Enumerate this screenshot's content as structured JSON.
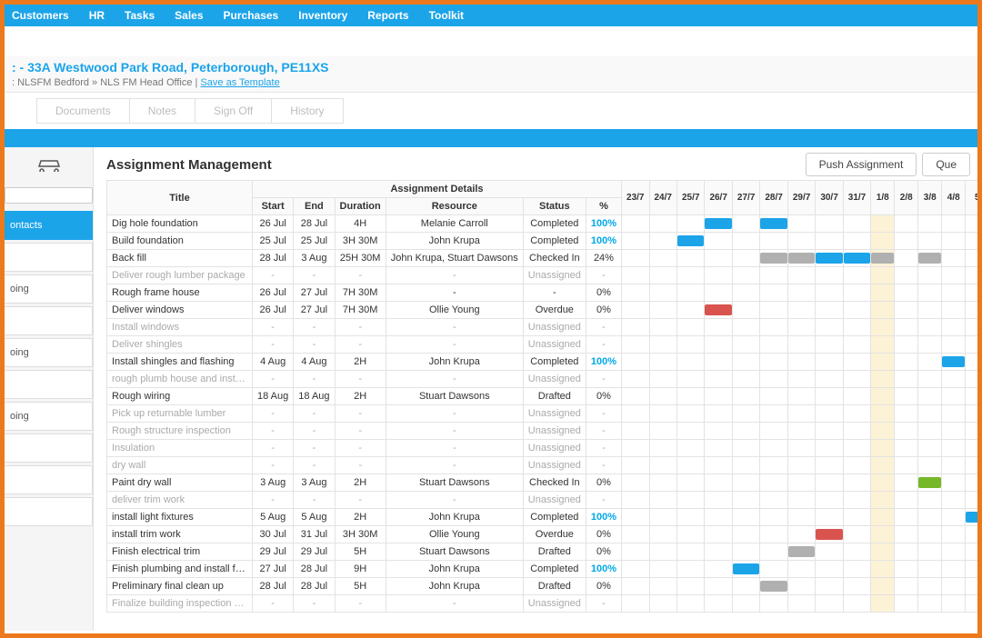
{
  "topnav": [
    "Customers",
    "HR",
    "Tasks",
    "Sales",
    "Purchases",
    "Inventory",
    "Reports",
    "Toolkit"
  ],
  "breadc": {
    "title": ": - 33A Westwood Park Road, Peterborough, PE11XS",
    "sub_prefix": ": NLSFM Bedford » NLS FM Head Office | ",
    "save_template": "Save as Template"
  },
  "tabs": [
    "Documents",
    "Notes",
    "Sign Off",
    "History"
  ],
  "sidebar": {
    "items": [
      {
        "label": "ontacts",
        "active": true
      },
      {
        "label": ""
      },
      {
        "label": "oing"
      },
      {
        "label": ""
      },
      {
        "label": "oing"
      },
      {
        "label": ""
      },
      {
        "label": "oing"
      },
      {
        "label": ""
      },
      {
        "label": ""
      },
      {
        "label": ""
      }
    ]
  },
  "content": {
    "heading": "Assignment Management",
    "push_btn": "Push Assignment",
    "queue_btn": "Que",
    "group_header": "Assignment Details",
    "columns": [
      "Title",
      "Start",
      "End",
      "Duration",
      "Resource",
      "Status",
      "%"
    ],
    "dates": [
      "23/7",
      "24/7",
      "25/7",
      "26/7",
      "27/7",
      "28/7",
      "29/7",
      "30/7",
      "31/7",
      "1/8",
      "2/8",
      "3/8",
      "4/8",
      "5"
    ],
    "highlight_index": 9,
    "rows": [
      {
        "title": "Dig hole foundation",
        "start": "26 Jul",
        "end": "28 Jul",
        "duration": "4H",
        "resource": "Melanie Carroll",
        "status": "Completed",
        "pct": "100%",
        "bars": [
          {
            "i": 3,
            "c": "blue"
          },
          {
            "i": 5,
            "c": "blue"
          }
        ]
      },
      {
        "title": "Build foundation",
        "start": "25 Jul",
        "end": "25 Jul",
        "duration": "3H 30M",
        "resource": "John Krupa",
        "status": "Completed",
        "pct": "100%",
        "bars": [
          {
            "i": 2,
            "c": "blue"
          }
        ]
      },
      {
        "title": "Back fill",
        "start": "28 Jul",
        "end": "3 Aug",
        "duration": "25H 30M",
        "resource": "John Krupa, Stuart Dawsons",
        "status": "Checked In",
        "pct": "24%",
        "bars": [
          {
            "i": 5,
            "c": "grey"
          },
          {
            "i": 6,
            "c": "grey"
          },
          {
            "i": 7,
            "c": "blue"
          },
          {
            "i": 8,
            "c": "blue"
          },
          {
            "i": 9,
            "c": "grey"
          },
          {
            "i": 11,
            "c": "grey"
          }
        ]
      },
      {
        "title": "Deliver rough lumber package",
        "start": "-",
        "end": "-",
        "duration": "-",
        "resource": "-",
        "status": "Unassigned",
        "pct": "-",
        "muted": true,
        "bars": []
      },
      {
        "title": "Rough frame house",
        "start": "26 Jul",
        "end": "27 Jul",
        "duration": "7H 30M",
        "resource": "-",
        "status": "-",
        "pct": "0%",
        "bars": []
      },
      {
        "title": "Deliver windows",
        "start": "26 Jul",
        "end": "27 Jul",
        "duration": "7H 30M",
        "resource": "Ollie Young",
        "status": "Overdue",
        "pct": "0%",
        "bars": [
          {
            "i": 3,
            "c": "red"
          }
        ]
      },
      {
        "title": "Install windows",
        "start": "-",
        "end": "-",
        "duration": "-",
        "resource": "-",
        "status": "Unassigned",
        "pct": "-",
        "muted": true,
        "bars": []
      },
      {
        "title": "Deliver shingles",
        "start": "-",
        "end": "-",
        "duration": "-",
        "resource": "-",
        "status": "Unassigned",
        "pct": "-",
        "muted": true,
        "bars": []
      },
      {
        "title": "Install shingles and flashing",
        "start": "4 Aug",
        "end": "4 Aug",
        "duration": "2H",
        "resource": "John Krupa",
        "status": "Completed",
        "pct": "100%",
        "bars": [
          {
            "i": 12,
            "c": "blue"
          }
        ]
      },
      {
        "title": "rough plumb house and install duct",
        "start": "-",
        "end": "-",
        "duration": "-",
        "resource": "-",
        "status": "Unassigned",
        "pct": "-",
        "muted": true,
        "bars": []
      },
      {
        "title": "Rough wiring",
        "start": "18 Aug",
        "end": "18 Aug",
        "duration": "2H",
        "resource": "Stuart Dawsons",
        "status": "Drafted",
        "pct": "0%",
        "bars": []
      },
      {
        "title": "Pick up returnable lumber",
        "start": "-",
        "end": "-",
        "duration": "-",
        "resource": "-",
        "status": "Unassigned",
        "pct": "-",
        "muted": true,
        "bars": []
      },
      {
        "title": "Rough structure inspection",
        "start": "-",
        "end": "-",
        "duration": "-",
        "resource": "-",
        "status": "Unassigned",
        "pct": "-",
        "muted": true,
        "bars": []
      },
      {
        "title": "Insulation",
        "start": "-",
        "end": "-",
        "duration": "-",
        "resource": "-",
        "status": "Unassigned",
        "pct": "-",
        "muted": true,
        "bars": []
      },
      {
        "title": "dry wall",
        "start": "-",
        "end": "-",
        "duration": "-",
        "resource": "-",
        "status": "Unassigned",
        "pct": "-",
        "muted": true,
        "bars": []
      },
      {
        "title": "Paint dry wall",
        "start": "3 Aug",
        "end": "3 Aug",
        "duration": "2H",
        "resource": "Stuart Dawsons",
        "status": "Checked In",
        "pct": "0%",
        "bars": [
          {
            "i": 11,
            "c": "green"
          }
        ]
      },
      {
        "title": "deliver trim work",
        "start": "-",
        "end": "-",
        "duration": "-",
        "resource": "-",
        "status": "Unassigned",
        "pct": "-",
        "muted": true,
        "bars": []
      },
      {
        "title": "install light fixtures",
        "start": "5 Aug",
        "end": "5 Aug",
        "duration": "2H",
        "resource": "John Krupa",
        "status": "Completed",
        "pct": "100%",
        "bars": [
          {
            "i": 13,
            "c": "blue"
          }
        ]
      },
      {
        "title": "install trim work",
        "start": "30 Jul",
        "end": "31 Jul",
        "duration": "3H 30M",
        "resource": "Ollie Young",
        "status": "Overdue",
        "pct": "0%",
        "bars": [
          {
            "i": 7,
            "c": "red"
          }
        ]
      },
      {
        "title": "Finish electrical trim",
        "start": "29 Jul",
        "end": "29 Jul",
        "duration": "5H",
        "resource": "Stuart Dawsons",
        "status": "Drafted",
        "pct": "0%",
        "bars": [
          {
            "i": 6,
            "c": "grey"
          }
        ]
      },
      {
        "title": "Finish plumbing and install furnace",
        "start": "27 Jul",
        "end": "28 Jul",
        "duration": "9H",
        "resource": "John Krupa",
        "status": "Completed",
        "pct": "100%",
        "bars": [
          {
            "i": 4,
            "c": "blue"
          }
        ]
      },
      {
        "title": "Preliminary final clean up",
        "start": "28 Jul",
        "end": "28 Jul",
        "duration": "5H",
        "resource": "John Krupa",
        "status": "Drafted",
        "pct": "0%",
        "bars": [
          {
            "i": 5,
            "c": "grey"
          }
        ]
      },
      {
        "title": "Finalize building inspection approva",
        "start": "-",
        "end": "-",
        "duration": "-",
        "resource": "-",
        "status": "Unassigned",
        "pct": "-",
        "muted": true,
        "bars": []
      }
    ]
  }
}
